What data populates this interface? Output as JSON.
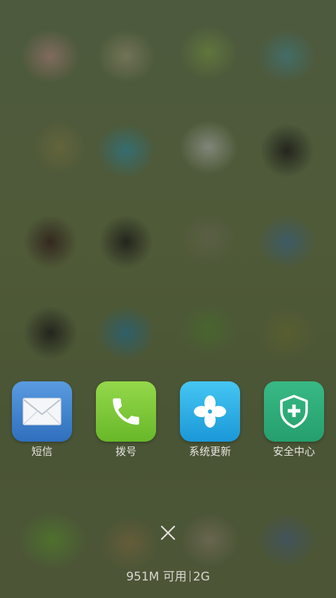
{
  "recent_apps": [
    {
      "label": "短信",
      "icon": "mail-icon",
      "color": "#3f83cf"
    },
    {
      "label": "拨号",
      "icon": "phone-icon",
      "color": "#7fc93a"
    },
    {
      "label": "系统更新",
      "icon": "clover-icon",
      "color": "#27aee8"
    },
    {
      "label": "安全中心",
      "icon": "shield-plus-icon",
      "color": "#2fae7a"
    }
  ],
  "close_icon": "close-icon",
  "memory": {
    "available": "951M 可用",
    "total": "2G"
  }
}
